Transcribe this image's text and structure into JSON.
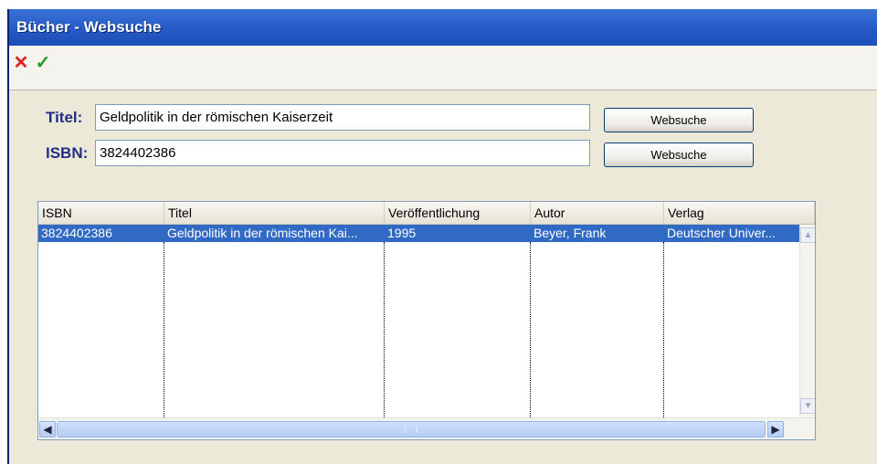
{
  "window": {
    "title": "Bücher - Websuche"
  },
  "toolbar": {
    "close_icon": "close-icon",
    "ok_icon": "check-icon"
  },
  "form": {
    "title_label": "Titel:",
    "title_value": "Geldpolitik in der römischen Kaiserzeit",
    "isbn_label": "ISBN:",
    "isbn_value": "3824402386",
    "search_button_label": "Websuche"
  },
  "results": {
    "columns": [
      "ISBN",
      "Titel",
      "Veröffentlichung",
      "Autor",
      "Verlag"
    ],
    "rows": [
      [
        "3824402386",
        "Geldpolitik in der römischen Kai...",
        "1995",
        "Beyer, Frank",
        "Deutscher Univer..."
      ]
    ]
  },
  "colors": {
    "titlebar": "#2458c4",
    "selection": "#316ac5",
    "label": "#1f2f86"
  }
}
